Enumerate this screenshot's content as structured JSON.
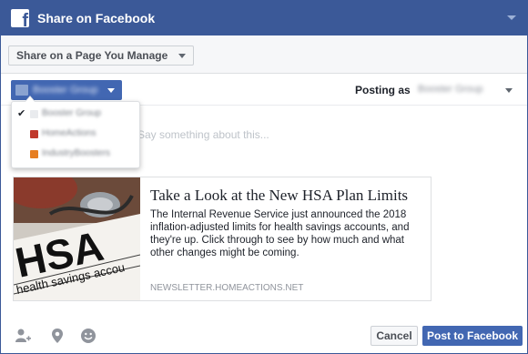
{
  "window": {
    "title": "Share on Facebook"
  },
  "share_target": {
    "selected": "Share on a Page You Manage"
  },
  "audience": {
    "page_name": "Booster Group",
    "posting_as_label": "Posting as",
    "posting_as_user": "Booster Group"
  },
  "composer": {
    "placeholder": "Say something about this..."
  },
  "page_dropdown": {
    "items": [
      {
        "label": "Booster Group",
        "selected": true,
        "thumb_color": "#e9ebee"
      },
      {
        "label": "HomeActions",
        "selected": false,
        "thumb_color": "#c0392b"
      },
      {
        "label": "IndustryBoosters",
        "selected": false,
        "thumb_color": "#e67e22"
      }
    ],
    "check_glyph": "✔"
  },
  "link_card": {
    "title": "Take a Look at the New HSA Plan Limits",
    "description": "The Internal Revenue Service just announced the 2018 inflation-adjusted limits for health savings accounts, and they're up. Click through to see by how much and what other changes might be coming.",
    "domain": "NEWSLETTER.HOMEACTIONS.NET",
    "image_text_big": "HSA",
    "image_text_small": "health savings accou"
  },
  "footer": {
    "icons": [
      "tag-friends-icon",
      "location-icon",
      "feeling-icon"
    ],
    "cancel_label": "Cancel",
    "post_label": "Post to Facebook"
  },
  "colors": {
    "brand": "#3b5998",
    "accent_button": "#4267b2"
  }
}
